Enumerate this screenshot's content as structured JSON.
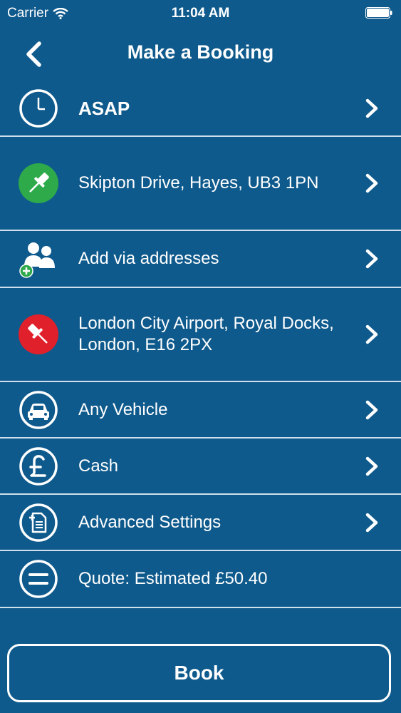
{
  "status_bar": {
    "carrier": "Carrier",
    "time": "11:04 AM"
  },
  "nav": {
    "title": "Make a Booking"
  },
  "rows": [
    {
      "label": "ASAP",
      "icon": "clock-icon"
    },
    {
      "label": "Skipton Drive, Hayes, UB3 1PN",
      "icon": "pickup-pin-icon",
      "color": "#2eaa4a"
    },
    {
      "label": "Add via addresses",
      "icon": "add-people-icon"
    },
    {
      "label": "London City Airport, Royal Docks, London, E16 2PX",
      "icon": "dropoff-pin-icon",
      "color": "#e0202a"
    },
    {
      "label": "Any Vehicle",
      "icon": "car-icon"
    },
    {
      "label": "Cash",
      "icon": "pound-icon"
    },
    {
      "label": "Advanced Settings",
      "icon": "settings-document-icon"
    },
    {
      "label": "Quote: Estimated £50.40",
      "icon": "equals-icon"
    }
  ],
  "book": {
    "label": "Book"
  },
  "colors": {
    "background": "#0f5a8c",
    "pickup": "#2eaa4a",
    "dropoff": "#e0202a",
    "divider": "#cfe0ec"
  }
}
